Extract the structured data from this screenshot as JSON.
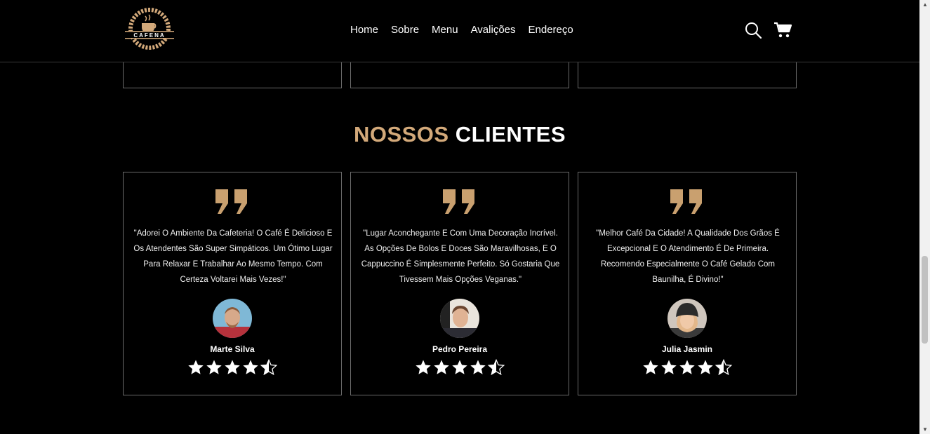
{
  "header": {
    "logo_text": "CAFENA",
    "nav": [
      "Home",
      "Sobre",
      "Menu",
      "Avalições",
      "Endereço"
    ]
  },
  "section": {
    "title_accent": "NOSSOS",
    "title_rest": "CLIENTES"
  },
  "testimonials": [
    {
      "text": "\"Adorei O Ambiente Da Cafeteria! O Café É Delicioso E Os Atendentes São Super Simpáticos. Um Ótimo Lugar Para Relaxar E Trabalhar Ao Mesmo Tempo. Com Certeza Voltarei Mais Vezes!\"",
      "name": "Marte Silva",
      "rating": 4.5
    },
    {
      "text": "\"Lugar Aconchegante E Com Uma Decoração Incrível. As Opções De Bolos E Doces São Maravilhosas, E O Cappuccino É Simplesmente Perfeito. Só Gostaria Que Tivessem Mais Opções Veganas.\"",
      "name": "Pedro Pereira",
      "rating": 4.5
    },
    {
      "text": "\"Melhor Café Da Cidade! A Qualidade Dos Grãos É Excepcional E O Atendimento É De Primeira. Recomendo Especialmente O Café Gelado Com Baunilha, É Divino!\"",
      "name": "Julia Jasmin",
      "rating": 4.5
    }
  ],
  "colors": {
    "accent": "#d3a97a",
    "background": "#000000",
    "border": "#6b6b6b"
  },
  "icons": [
    "coffee-logo-icon",
    "search-icon",
    "cart-icon",
    "quote-icon",
    "star-icon",
    "half-star-icon"
  ]
}
